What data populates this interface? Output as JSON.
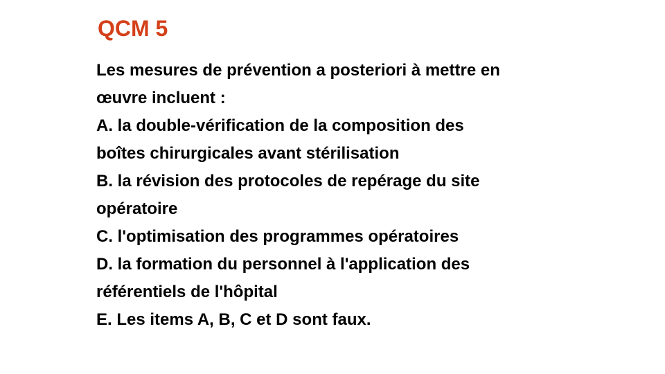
{
  "slide": {
    "title": "QCM 5",
    "question": {
      "line1": "Les mesures de prévention a posteriori à mettre en",
      "line2": "œuvre incluent  :"
    },
    "options": [
      {
        "line1": "A. la double-vérification de la composition des",
        "line2": "boîtes chirurgicales avant stérilisation"
      },
      {
        "line1": "B. la révision des protocoles de repérage du site",
        "line2": "opératoire"
      },
      {
        "line1": "C. l'optimisation des programmes opératoires"
      },
      {
        "line1": "D. la formation du personnel à l'application des",
        "line2": "référentiels de l'hôpital"
      },
      {
        "line1": "E. Les items A, B, C et D sont faux."
      }
    ],
    "colors": {
      "title": "#d4401a",
      "text": "#000000",
      "background": "#ffffff"
    }
  }
}
